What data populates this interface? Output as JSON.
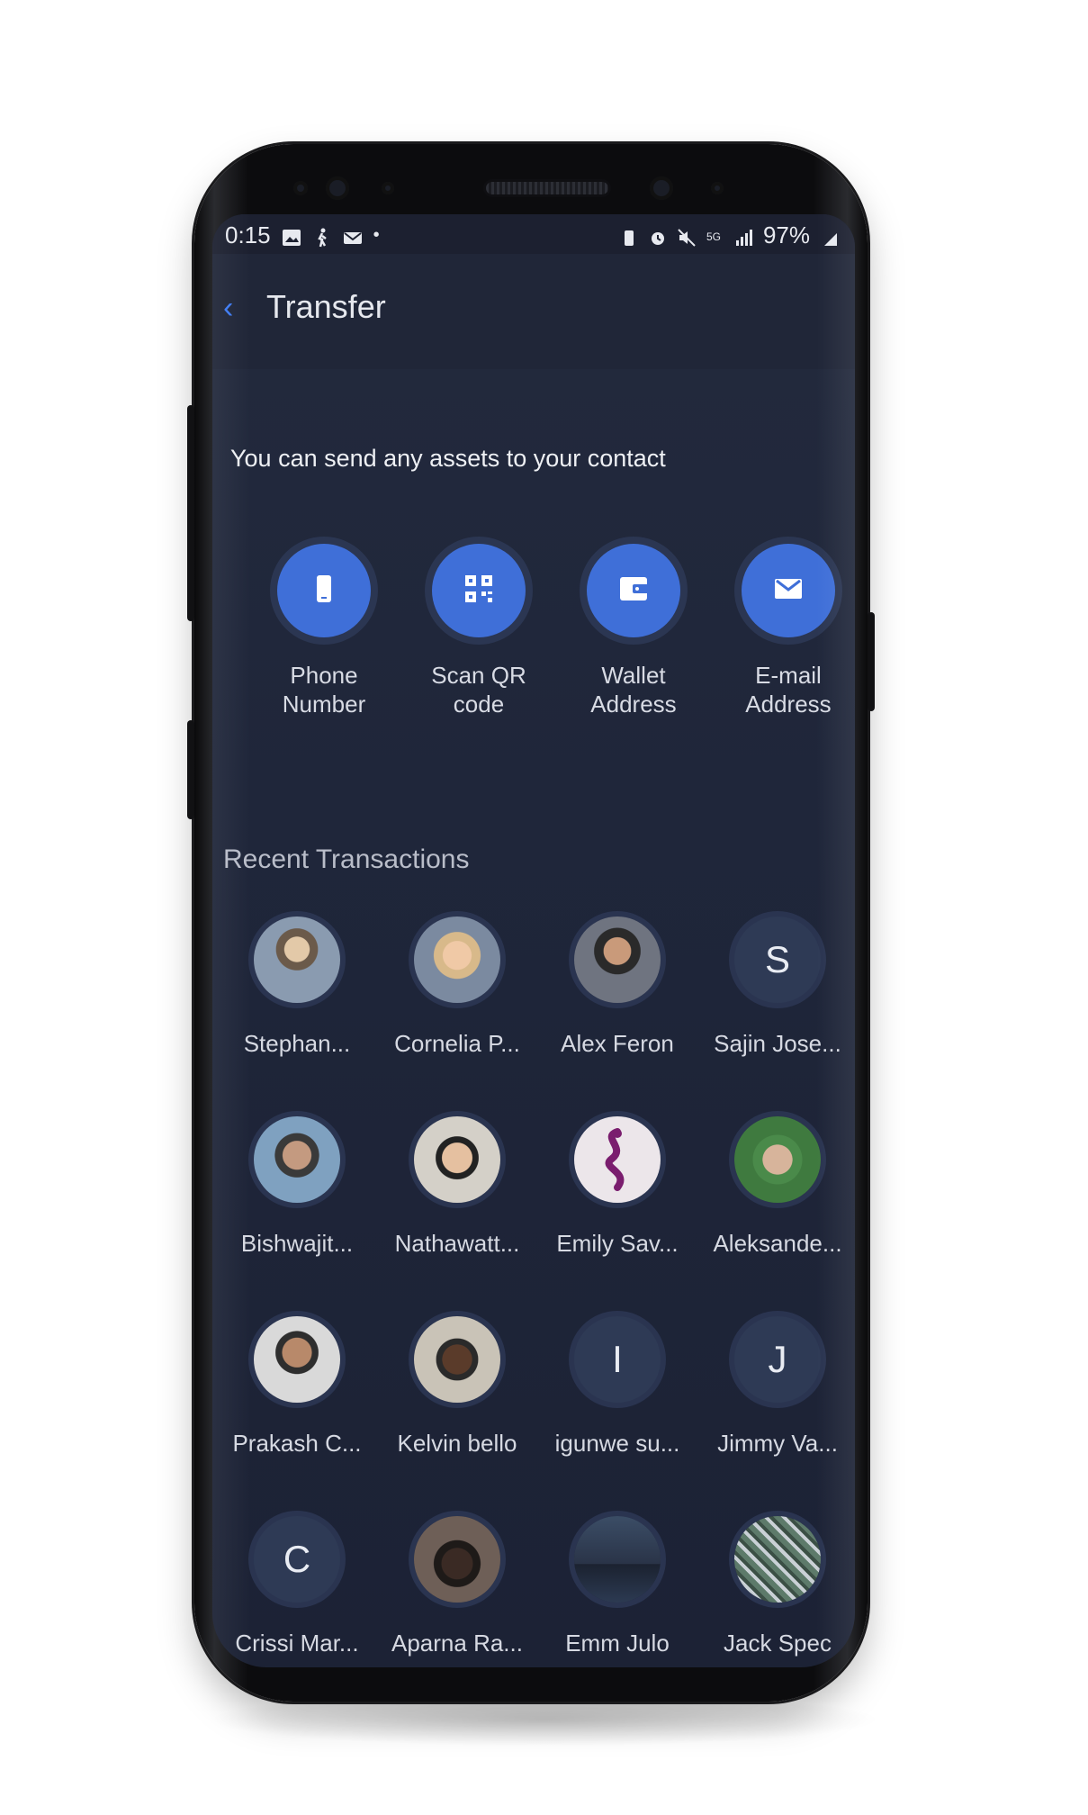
{
  "status": {
    "time": "0:15",
    "battery": "97%"
  },
  "header": {
    "title": "Transfer"
  },
  "intro": "You can send any assets to your contact",
  "actions": [
    {
      "label": "Phone\nNumber",
      "icon": "phone-icon"
    },
    {
      "label": "Scan QR\ncode",
      "icon": "qr-code-icon"
    },
    {
      "label": "Wallet\nAddress",
      "icon": "wallet-icon"
    },
    {
      "label": "E-mail\nAddress",
      "icon": "email-icon"
    }
  ],
  "recent": {
    "title": "Recent Transactions",
    "contacts": [
      {
        "name": "Stephan...",
        "initial": ""
      },
      {
        "name": "Cornelia P...",
        "initial": ""
      },
      {
        "name": "Alex Feron",
        "initial": ""
      },
      {
        "name": "Sajin Jose...",
        "initial": "S"
      },
      {
        "name": "Bishwajit...",
        "initial": ""
      },
      {
        "name": "Nathawatt...",
        "initial": ""
      },
      {
        "name": "Emily Sav...",
        "initial": ""
      },
      {
        "name": "Aleksande...",
        "initial": ""
      },
      {
        "name": "Prakash C...",
        "initial": ""
      },
      {
        "name": "Kelvin bello",
        "initial": ""
      },
      {
        "name": "igunwe su...",
        "initial": "I"
      },
      {
        "name": "Jimmy Va...",
        "initial": "J"
      },
      {
        "name": "Crissi Mar...",
        "initial": "C"
      },
      {
        "name": "Aparna Ra...",
        "initial": ""
      },
      {
        "name": "Emm Julo",
        "initial": ""
      },
      {
        "name": "Jack Spec",
        "initial": ""
      }
    ]
  },
  "colors": {
    "accent": "#3f6fd8",
    "background": "#1f263a"
  }
}
